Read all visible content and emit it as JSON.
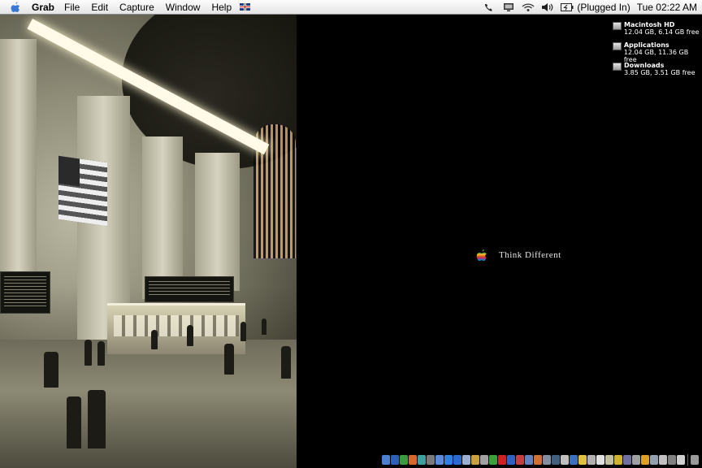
{
  "menubar": {
    "app_name": "Grab",
    "menus": [
      "File",
      "Edit",
      "Capture",
      "Window",
      "Help"
    ],
    "battery_status": "(Plugged In)",
    "clock": "Tue 02:22 AM"
  },
  "desktop": {
    "tagline": "Think Different",
    "disks": [
      {
        "name": "Macintosh HD",
        "info": "12.04 GB, 6.14 GB free"
      },
      {
        "name": "Applications",
        "info": "12.04 GB, 11.36 GB free"
      },
      {
        "name": "Downloads",
        "info": "3.85 GB, 3.51 GB free"
      }
    ]
  },
  "dock": {
    "items": [
      {
        "icon": "finder-icon",
        "color": "#4a7fd0"
      },
      {
        "icon": "word-icon",
        "color": "#2c5fb8"
      },
      {
        "icon": "excel-icon",
        "color": "#3c9a3a"
      },
      {
        "icon": "powerpoint-icon",
        "color": "#d6662a"
      },
      {
        "icon": "dreamweaver-icon",
        "color": "#3aa0a0"
      },
      {
        "icon": "app-icon",
        "color": "#7a7a7a"
      },
      {
        "icon": "app-icon",
        "color": "#5a8ad8"
      },
      {
        "icon": "safari-icon",
        "color": "#2f7fe0"
      },
      {
        "icon": "ie-icon",
        "color": "#2a6ad0"
      },
      {
        "icon": "app-icon",
        "color": "#9ab0d0"
      },
      {
        "icon": "app-icon",
        "color": "#c8a040"
      },
      {
        "icon": "app-icon",
        "color": "#a0a0a0"
      },
      {
        "icon": "app-icon",
        "color": "#38a038"
      },
      {
        "icon": "app-icon",
        "color": "#d02020"
      },
      {
        "icon": "app-icon",
        "color": "#3060c0"
      },
      {
        "icon": "app-icon",
        "color": "#c04040"
      },
      {
        "icon": "app-icon",
        "color": "#6080c0"
      },
      {
        "icon": "app-icon",
        "color": "#d07030"
      },
      {
        "icon": "app-icon",
        "color": "#8090a0"
      },
      {
        "icon": "app-icon",
        "color": "#406080"
      },
      {
        "icon": "app-icon",
        "color": "#c0c0c0"
      },
      {
        "icon": "app-icon",
        "color": "#3a70c0"
      },
      {
        "icon": "app-icon",
        "color": "#e0c040"
      },
      {
        "icon": "app-icon",
        "color": "#b0b0b0"
      },
      {
        "icon": "app-icon",
        "color": "#e0e0e0"
      },
      {
        "icon": "app-icon",
        "color": "#c0c0a0"
      },
      {
        "icon": "app-icon",
        "color": "#d0b030"
      },
      {
        "icon": "app-icon",
        "color": "#7070a0"
      },
      {
        "icon": "app-icon",
        "color": "#a0a0a0"
      },
      {
        "icon": "app-icon",
        "color": "#e0a020"
      },
      {
        "icon": "app-icon",
        "color": "#90a0b0"
      },
      {
        "icon": "app-icon",
        "color": "#c0c0c0"
      },
      {
        "icon": "app-icon",
        "color": "#808080"
      },
      {
        "icon": "app-icon",
        "color": "#d0d0d0"
      },
      {
        "icon": "trash-icon",
        "color": "#9a9a9a"
      }
    ]
  }
}
